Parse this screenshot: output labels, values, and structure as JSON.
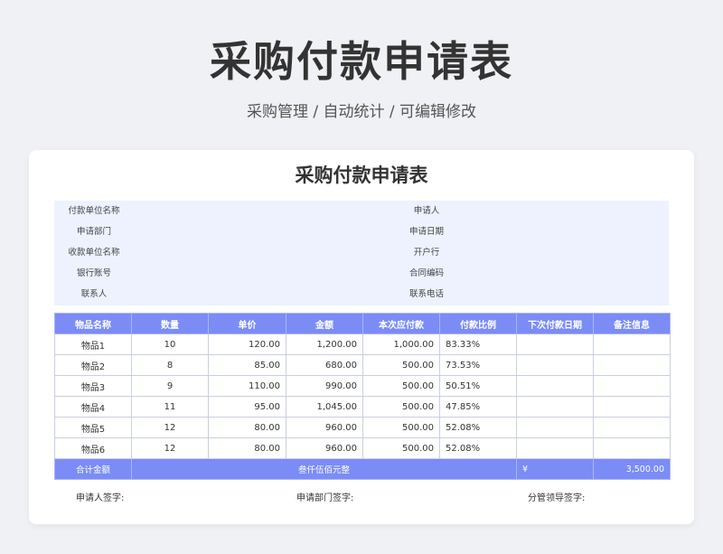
{
  "page": {
    "title": "采购付款申请表",
    "subtitle": "采购管理 /  自动统计  /  可编辑修改"
  },
  "form": {
    "title": "采购付款申请表",
    "info_rows": [
      {
        "label1": "付款单位名称",
        "value1": "",
        "label2": "申请人",
        "value2": ""
      },
      {
        "label1": "申请部门",
        "value1": "",
        "label2": "申请日期",
        "value2": ""
      },
      {
        "label1": "收款单位名称",
        "value1": "",
        "label2": "开户行",
        "value2": ""
      },
      {
        "label1": "银行账号",
        "value1": "",
        "label2": "合同编码",
        "value2": ""
      },
      {
        "label1": "联系人",
        "value1": "",
        "label2": "联系电话",
        "value2": ""
      }
    ],
    "columns": [
      "物品名称",
      "数量",
      "单价",
      "金额",
      "本次应付款",
      "付款比例",
      "下次付款日期",
      "备注信息"
    ],
    "rows": [
      [
        "物品1",
        "10",
        "120.00",
        "1,200.00",
        "1,000.00",
        "83.33%",
        "",
        ""
      ],
      [
        "物品2",
        "8",
        "85.00",
        "680.00",
        "500.00",
        "73.53%",
        "",
        ""
      ],
      [
        "物品3",
        "9",
        "110.00",
        "990.00",
        "500.00",
        "50.51%",
        "",
        ""
      ],
      [
        "物品4",
        "11",
        "95.00",
        "1,045.00",
        "500.00",
        "47.85%",
        "",
        ""
      ],
      [
        "物品5",
        "12",
        "80.00",
        "960.00",
        "500.00",
        "52.08%",
        "",
        ""
      ],
      [
        "物品6",
        "12",
        "80.00",
        "960.00",
        "500.00",
        "52.08%",
        "",
        ""
      ]
    ],
    "total": {
      "label": "合计金额",
      "amount_words": "叁仟伍佰元整",
      "currency": "¥",
      "amount": "3,500.00"
    },
    "signatures": {
      "applicant": "申请人签字:",
      "department": "申请部门签字:",
      "leader": "分管领导签字:"
    }
  },
  "colors": {
    "accent": "#7b8cf6",
    "info_bg": "#eef2ff",
    "background": "#f0f1f4"
  }
}
